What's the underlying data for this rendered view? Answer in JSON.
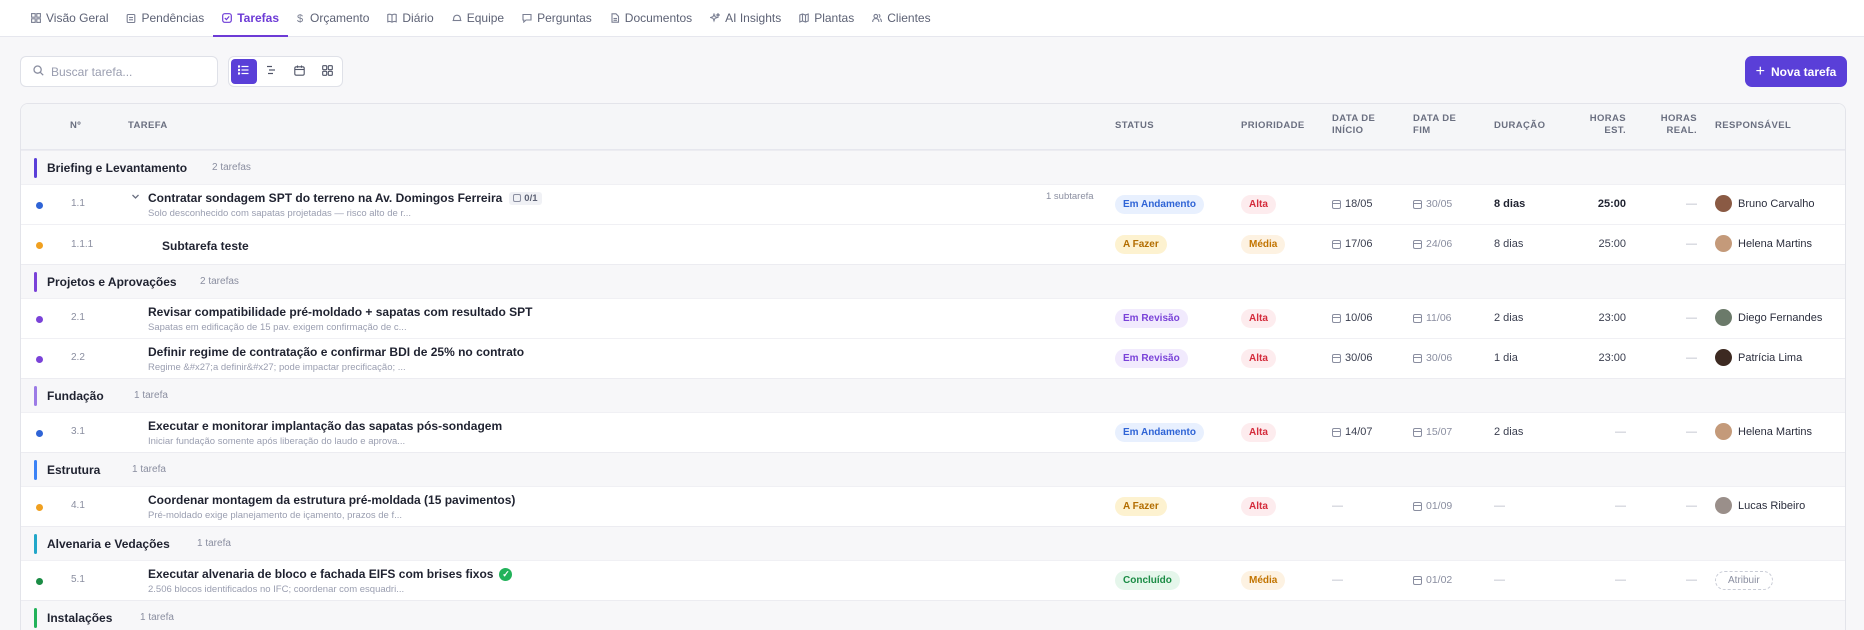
{
  "nav": {
    "items": [
      {
        "label": "Visão Geral",
        "icon": "grid-icon"
      },
      {
        "label": "Pendências",
        "icon": "clipboard-icon"
      },
      {
        "label": "Tarefas",
        "icon": "check-square-icon",
        "active": true
      },
      {
        "label": "Orçamento",
        "icon": "dollar-icon"
      },
      {
        "label": "Diário",
        "icon": "book-icon"
      },
      {
        "label": "Equipe",
        "icon": "hard-hat-icon"
      },
      {
        "label": "Perguntas",
        "icon": "message-icon"
      },
      {
        "label": "Documentos",
        "icon": "file-icon"
      },
      {
        "label": "AI Insights",
        "icon": "sparkles-icon"
      },
      {
        "label": "Plantas",
        "icon": "map-icon"
      },
      {
        "label": "Clientes",
        "icon": "users-icon"
      }
    ]
  },
  "toolbar": {
    "search_placeholder": "Buscar tarefa...",
    "views": [
      "list-view-icon",
      "gantt-view-icon",
      "calendar-view-icon",
      "board-view-icon"
    ],
    "new_task_label": "Nova tarefa"
  },
  "columns": {
    "num": "Nº",
    "task": "TAREFA",
    "status": "STATUS",
    "priority": "PRIORIDADE",
    "start": [
      "DATA DE",
      "INÍCIO"
    ],
    "end": [
      "DATA DE",
      "FIM"
    ],
    "duration": "DURAÇÃO",
    "est": [
      "HORAS",
      "EST."
    ],
    "real": [
      "HORAS",
      "REAL."
    ],
    "owner": "RESPONSÁVEL"
  },
  "groups": [
    {
      "name": "Briefing e Levantamento",
      "count": "2 tarefas",
      "color": "#5a3fd8"
    },
    {
      "name": "Projetos e Aprovações",
      "count": "2 tarefas",
      "color": "#7a42d8"
    },
    {
      "name": "Fundação",
      "count": "1 tarefa",
      "color": "#9c7be6"
    },
    {
      "name": "Estrutura",
      "count": "1 tarefa",
      "color": "#3b82f6"
    },
    {
      "name": "Alvenaria e Vedações",
      "count": "1 tarefa",
      "color": "#22a7c9"
    },
    {
      "name": "Instalações",
      "count": "1 tarefa",
      "color": "#22b25a"
    }
  ],
  "tasks": [
    {
      "num": "1.1",
      "title": "Contratar sondagem SPT do terreno na Av. Domingos Ferreira",
      "subtasks_badge": "0/1",
      "subtask_count": "1 subtarefa",
      "desc": "Solo desconhecido com sapatas projetadas — risco alto de r...",
      "status": "Em Andamento",
      "priority": "Alta",
      "start": "18/05",
      "end": "30/05",
      "duration": "8 dias",
      "est": "25:00",
      "real": "—",
      "owner": "Bruno Carvalho",
      "dot": "#2f64d6"
    },
    {
      "num": "1.1.1",
      "title": "Subtarefa teste",
      "status": "A Fazer",
      "priority": "Média",
      "start": "17/06",
      "end": "24/06",
      "duration": "8 dias",
      "est": "25:00",
      "real": "—",
      "owner": "Helena Martins",
      "dot": "#f0a020"
    },
    {
      "num": "2.1",
      "title": "Revisar compatibilidade pré-moldado + sapatas com resultado SPT",
      "desc": "Sapatas em edificação de 15 pav. exigem confirmação de c...",
      "status": "Em Revisão",
      "priority": "Alta",
      "start": "10/06",
      "end": "11/06",
      "duration": "2 dias",
      "est": "23:00",
      "real": "—",
      "owner": "Diego Fernandes",
      "dot": "#7a42d8"
    },
    {
      "num": "2.2",
      "title": "Definir regime de contratação e confirmar BDI de 25% no contrato",
      "desc": "Regime &#x27;a definir&#x27; pode impactar precificação; ...",
      "status": "Em Revisão",
      "priority": "Alta",
      "start": "30/06",
      "end": "30/06",
      "duration": "1 dia",
      "est": "23:00",
      "real": "—",
      "owner": "Patrícia Lima",
      "dot": "#7a42d8"
    },
    {
      "num": "3.1",
      "title": "Executar e monitorar implantação das sapatas pós-sondagem",
      "desc": "Iniciar fundação somente após liberação do laudo e aprova...",
      "status": "Em Andamento",
      "priority": "Alta",
      "start": "14/07",
      "end": "15/07",
      "duration": "2 dias",
      "est": "—",
      "real": "—",
      "owner": "Helena Martins",
      "dot": "#2f64d6"
    },
    {
      "num": "4.1",
      "title": "Coordenar montagem da estrutura pré-moldada (15 pavimentos)",
      "desc": "Pré-moldado exige planejamento de içamento, prazos de f...",
      "status": "A Fazer",
      "priority": "Alta",
      "start": "—",
      "end": "01/09",
      "duration": "—",
      "est": "—",
      "real": "—",
      "owner": "Lucas Ribeiro",
      "dot": "#f0a020"
    },
    {
      "num": "5.1",
      "title": "Executar alvenaria de bloco e fachada EIFS com brises fixos",
      "desc": "2.506 blocos identificados no IFC; coordenar com esquadri...",
      "status": "Concluído",
      "priority": "Média",
      "start": "—",
      "end": "01/02",
      "duration": "—",
      "est": "—",
      "real": "—",
      "owner_button": "Atribuir",
      "dot": "#1b8c45"
    }
  ]
}
